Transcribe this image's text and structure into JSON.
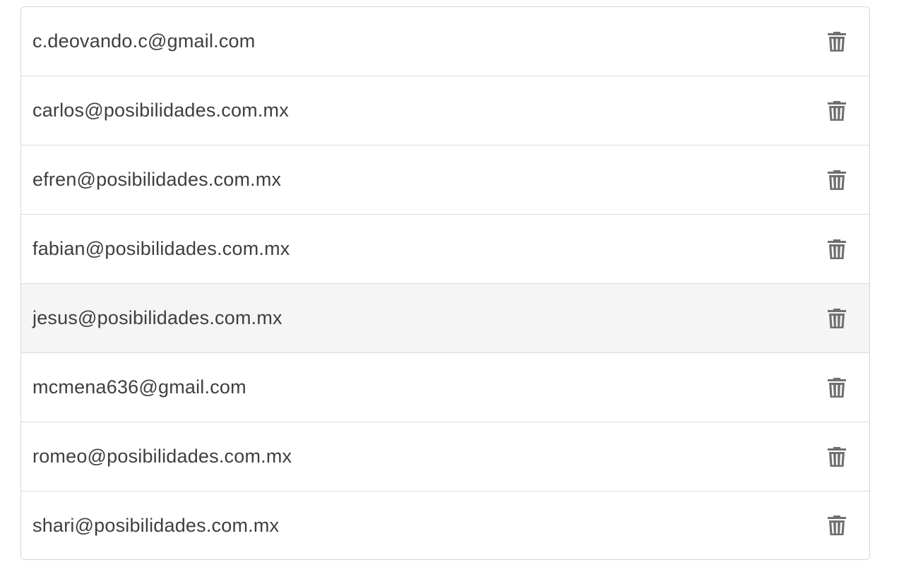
{
  "email_list": {
    "items": [
      {
        "email": "c.deovando.c@gmail.com",
        "icon": "trash-icon"
      },
      {
        "email": "carlos@posibilidades.com.mx",
        "icon": "trash-icon"
      },
      {
        "email": "efren@posibilidades.com.mx",
        "icon": "trash-icon"
      },
      {
        "email": "fabian@posibilidades.com.mx",
        "icon": "trash-icon"
      },
      {
        "email": "jesus@posibilidades.com.mx",
        "icon": "trash-icon",
        "hovered": true
      },
      {
        "email": "mcmena636@gmail.com",
        "icon": "trash-icon"
      },
      {
        "email": "romeo@posibilidades.com.mx",
        "icon": "trash-icon"
      },
      {
        "email": "shari@posibilidades.com.mx",
        "icon": "trash-icon"
      }
    ]
  },
  "colors": {
    "text": "#3c4043",
    "icon": "#707070",
    "border": "#dcdcdc",
    "hover_row": "#f5f5f5"
  }
}
